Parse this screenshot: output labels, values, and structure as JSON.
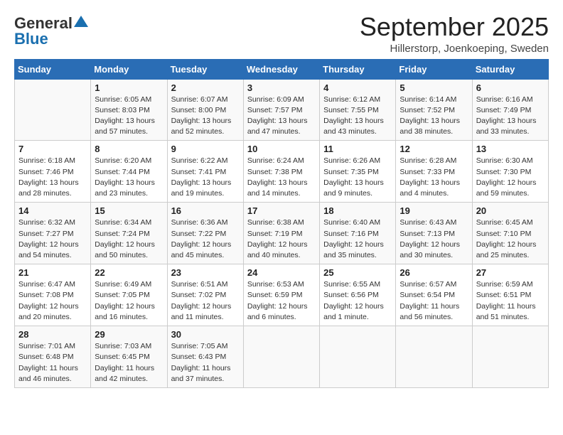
{
  "logo": {
    "general": "General",
    "blue": "Blue",
    "triangle": "▲"
  },
  "title": "September 2025",
  "subtitle": "Hillerstorp, Joenkoeping, Sweden",
  "weekdays": [
    "Sunday",
    "Monday",
    "Tuesday",
    "Wednesday",
    "Thursday",
    "Friday",
    "Saturday"
  ],
  "weeks": [
    [
      {
        "day": "",
        "info": ""
      },
      {
        "day": "1",
        "info": "Sunrise: 6:05 AM\nSunset: 8:03 PM\nDaylight: 13 hours\nand 57 minutes."
      },
      {
        "day": "2",
        "info": "Sunrise: 6:07 AM\nSunset: 8:00 PM\nDaylight: 13 hours\nand 52 minutes."
      },
      {
        "day": "3",
        "info": "Sunrise: 6:09 AM\nSunset: 7:57 PM\nDaylight: 13 hours\nand 47 minutes."
      },
      {
        "day": "4",
        "info": "Sunrise: 6:12 AM\nSunset: 7:55 PM\nDaylight: 13 hours\nand 43 minutes."
      },
      {
        "day": "5",
        "info": "Sunrise: 6:14 AM\nSunset: 7:52 PM\nDaylight: 13 hours\nand 38 minutes."
      },
      {
        "day": "6",
        "info": "Sunrise: 6:16 AM\nSunset: 7:49 PM\nDaylight: 13 hours\nand 33 minutes."
      }
    ],
    [
      {
        "day": "7",
        "info": "Sunrise: 6:18 AM\nSunset: 7:46 PM\nDaylight: 13 hours\nand 28 minutes."
      },
      {
        "day": "8",
        "info": "Sunrise: 6:20 AM\nSunset: 7:44 PM\nDaylight: 13 hours\nand 23 minutes."
      },
      {
        "day": "9",
        "info": "Sunrise: 6:22 AM\nSunset: 7:41 PM\nDaylight: 13 hours\nand 19 minutes."
      },
      {
        "day": "10",
        "info": "Sunrise: 6:24 AM\nSunset: 7:38 PM\nDaylight: 13 hours\nand 14 minutes."
      },
      {
        "day": "11",
        "info": "Sunrise: 6:26 AM\nSunset: 7:35 PM\nDaylight: 13 hours\nand 9 minutes."
      },
      {
        "day": "12",
        "info": "Sunrise: 6:28 AM\nSunset: 7:33 PM\nDaylight: 13 hours\nand 4 minutes."
      },
      {
        "day": "13",
        "info": "Sunrise: 6:30 AM\nSunset: 7:30 PM\nDaylight: 12 hours\nand 59 minutes."
      }
    ],
    [
      {
        "day": "14",
        "info": "Sunrise: 6:32 AM\nSunset: 7:27 PM\nDaylight: 12 hours\nand 54 minutes."
      },
      {
        "day": "15",
        "info": "Sunrise: 6:34 AM\nSunset: 7:24 PM\nDaylight: 12 hours\nand 50 minutes."
      },
      {
        "day": "16",
        "info": "Sunrise: 6:36 AM\nSunset: 7:22 PM\nDaylight: 12 hours\nand 45 minutes."
      },
      {
        "day": "17",
        "info": "Sunrise: 6:38 AM\nSunset: 7:19 PM\nDaylight: 12 hours\nand 40 minutes."
      },
      {
        "day": "18",
        "info": "Sunrise: 6:40 AM\nSunset: 7:16 PM\nDaylight: 12 hours\nand 35 minutes."
      },
      {
        "day": "19",
        "info": "Sunrise: 6:43 AM\nSunset: 7:13 PM\nDaylight: 12 hours\nand 30 minutes."
      },
      {
        "day": "20",
        "info": "Sunrise: 6:45 AM\nSunset: 7:10 PM\nDaylight: 12 hours\nand 25 minutes."
      }
    ],
    [
      {
        "day": "21",
        "info": "Sunrise: 6:47 AM\nSunset: 7:08 PM\nDaylight: 12 hours\nand 20 minutes."
      },
      {
        "day": "22",
        "info": "Sunrise: 6:49 AM\nSunset: 7:05 PM\nDaylight: 12 hours\nand 16 minutes."
      },
      {
        "day": "23",
        "info": "Sunrise: 6:51 AM\nSunset: 7:02 PM\nDaylight: 12 hours\nand 11 minutes."
      },
      {
        "day": "24",
        "info": "Sunrise: 6:53 AM\nSunset: 6:59 PM\nDaylight: 12 hours\nand 6 minutes."
      },
      {
        "day": "25",
        "info": "Sunrise: 6:55 AM\nSunset: 6:56 PM\nDaylight: 12 hours\nand 1 minute."
      },
      {
        "day": "26",
        "info": "Sunrise: 6:57 AM\nSunset: 6:54 PM\nDaylight: 11 hours\nand 56 minutes."
      },
      {
        "day": "27",
        "info": "Sunrise: 6:59 AM\nSunset: 6:51 PM\nDaylight: 11 hours\nand 51 minutes."
      }
    ],
    [
      {
        "day": "28",
        "info": "Sunrise: 7:01 AM\nSunset: 6:48 PM\nDaylight: 11 hours\nand 46 minutes."
      },
      {
        "day": "29",
        "info": "Sunrise: 7:03 AM\nSunset: 6:45 PM\nDaylight: 11 hours\nand 42 minutes."
      },
      {
        "day": "30",
        "info": "Sunrise: 7:05 AM\nSunset: 6:43 PM\nDaylight: 11 hours\nand 37 minutes."
      },
      {
        "day": "",
        "info": ""
      },
      {
        "day": "",
        "info": ""
      },
      {
        "day": "",
        "info": ""
      },
      {
        "day": "",
        "info": ""
      }
    ]
  ]
}
